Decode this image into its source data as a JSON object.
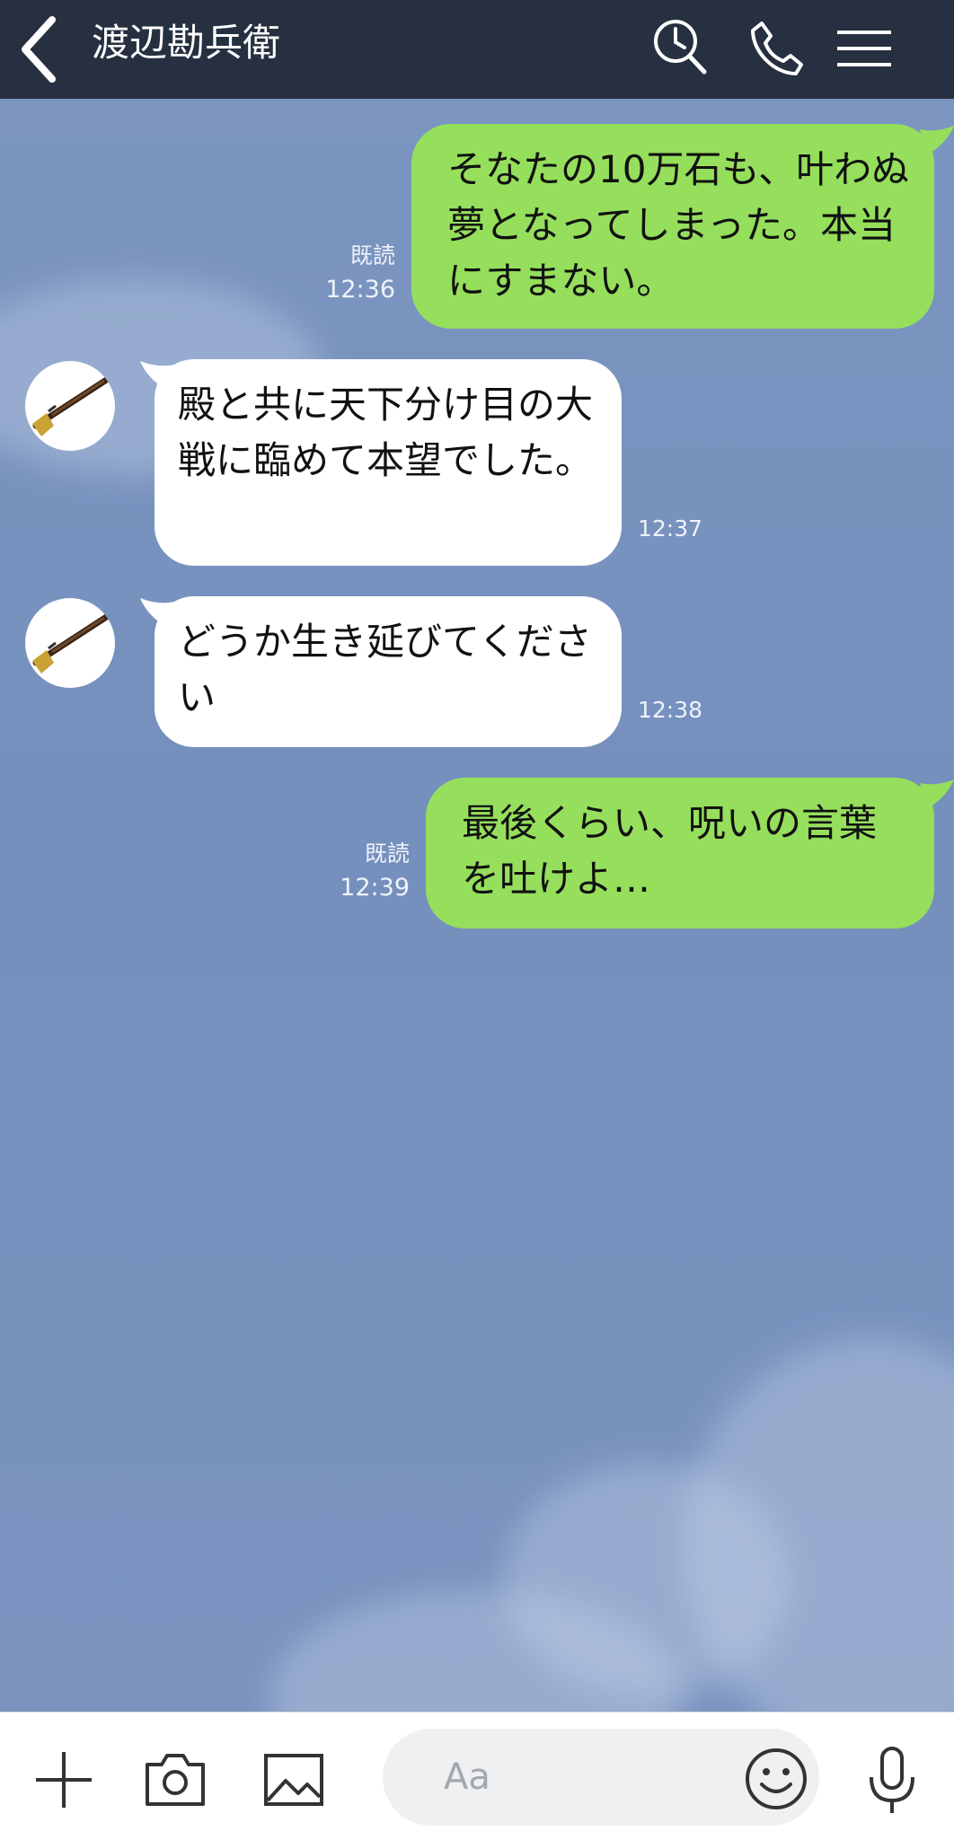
{
  "header": {
    "title": "渡辺勘兵衛",
    "back_icon": "chevron-left-icon",
    "icons": [
      "clock-search-icon",
      "phone-icon",
      "menu-icon"
    ],
    "background": "#263040"
  },
  "chat": {
    "colors": {
      "sent_bubble": "#95df5c",
      "received_bubble": "#ffffff",
      "background": "#7a93bf"
    },
    "messages": [
      {
        "sender": "me",
        "text": "そなたの10万石も、叶わぬ夢となってしまった。本当にすまない。",
        "read": "既読",
        "time": "12:36"
      },
      {
        "sender": "them",
        "text": "殿と共に天下分け目の大戦に臨めて本望でした。",
        "time": "12:37"
      },
      {
        "sender": "them",
        "text": "どうか生き延びてください",
        "time": "12:38"
      },
      {
        "sender": "me",
        "text": "最後くらい、呪いの言葉を吐けよ…",
        "read": "既読",
        "time": "12:39"
      }
    ]
  },
  "inputbar": {
    "placeholder": "Aa",
    "icons": [
      "plus-icon",
      "camera-icon",
      "image-icon",
      "emoji-icon",
      "microphone-icon"
    ]
  }
}
